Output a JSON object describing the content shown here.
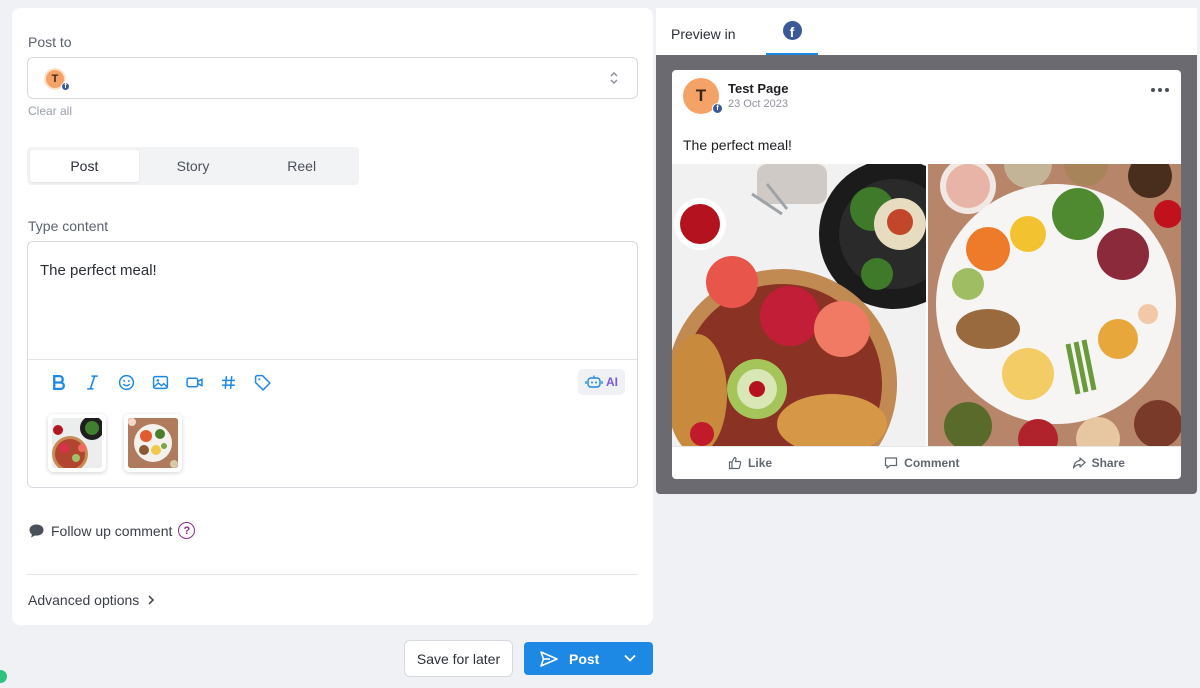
{
  "composer": {
    "post_to_label": "Post to",
    "account_initial": "T",
    "clear_all": "Clear all",
    "post_types": [
      {
        "label": "Post",
        "active": true
      },
      {
        "label": "Story",
        "active": false
      },
      {
        "label": "Reel",
        "active": false
      }
    ],
    "type_content_label": "Type content",
    "content": "The perfect meal!",
    "toolbar": [
      "bold-icon",
      "italic-icon",
      "emoji-icon",
      "image-icon",
      "video-icon",
      "hashtag-icon",
      "tag-icon"
    ],
    "ai_label": "AI",
    "attachments": [
      "attachment-thumbnail-1",
      "attachment-thumbnail-2"
    ],
    "follow_up_label": "Follow up comment",
    "help_glyph": "?",
    "advanced_label": "Advanced options"
  },
  "footer": {
    "save_later": "Save for later",
    "post": "Post"
  },
  "preview": {
    "label": "Preview in",
    "network_glyph": "f",
    "page_initial": "T",
    "page_name": "Test Page",
    "date": "23 Oct 2023",
    "caption": "The perfect meal!",
    "actions": {
      "like": "Like",
      "comment": "Comment",
      "share": "Share"
    }
  },
  "colors": {
    "accent": "#1e88e5",
    "facebook": "#3b5998",
    "avatar": "#f5a266",
    "ai": "#7c5bd6"
  }
}
